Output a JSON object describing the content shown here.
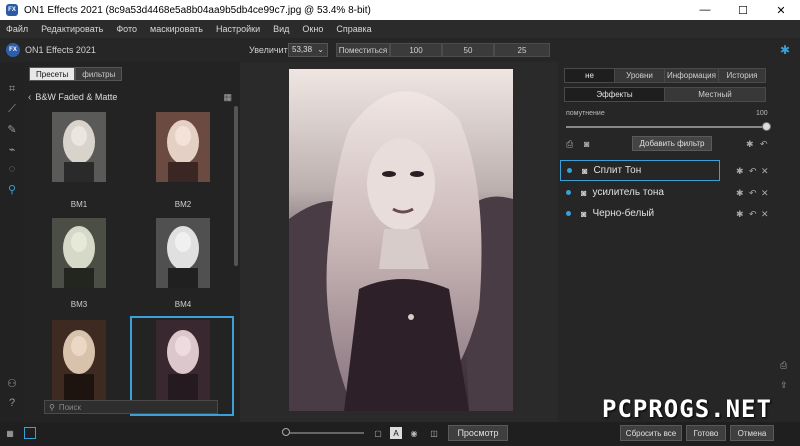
{
  "window": {
    "title": "ON1 Effects 2021 (8c9a53d4468e5a8b04aa9b5db4ce99c7.jpg @ 53.4% 8-bit)",
    "minimize": "—",
    "maximize": "☐",
    "close": "✕"
  },
  "menu": [
    "Файл",
    "Редактировать",
    "Фото",
    "маскировать",
    "Настройки",
    "Вид",
    "Окно",
    "Справка"
  ],
  "toolbar": {
    "logo_text": "FX",
    "product": "ON1 Effects 2021",
    "zoom_label": "Увеличить",
    "zoom_value": "53,38",
    "zoom_dropdown": "⌄",
    "fit_label": "Поместиться",
    "zoom_presets": [
      "100",
      "50",
      "25"
    ]
  },
  "browser": {
    "tabs": [
      {
        "label": "Пресеты",
        "active": true
      },
      {
        "label": "фильтры",
        "active": false
      }
    ],
    "category": "B&W Faded & Matte",
    "presets": [
      {
        "label": "BM1"
      },
      {
        "label": "BM2"
      },
      {
        "label": "BM3"
      },
      {
        "label": "BM4"
      },
      {
        "label": ""
      },
      {
        "label": ""
      }
    ],
    "selected_index": 5,
    "search_placeholder": "Поиск"
  },
  "right_panel": {
    "top_tabs": [
      {
        "label": "не",
        "active": true
      },
      {
        "label": "Уровни",
        "active": false
      },
      {
        "label": "Информация",
        "active": false
      },
      {
        "label": "История",
        "active": false
      }
    ],
    "mode_tabs": [
      {
        "label": "Эффекты",
        "active": true
      },
      {
        "label": "Местный",
        "active": false
      }
    ],
    "opacity_label": "помутнение",
    "opacity_value": "100",
    "add_filter_label": "Добавить фильтр",
    "filters": [
      {
        "name": "Сплит Тон",
        "selected": true
      },
      {
        "name": "усилитель тона",
        "selected": false
      },
      {
        "name": "Черно-белый",
        "selected": false
      }
    ]
  },
  "bottom": {
    "preview_label": "Просмотр",
    "reset_label": "Сбросить все",
    "done_label": "Готово",
    "cancel_label": "Отмена"
  },
  "watermark": "PCPROGS.NET",
  "icons": [
    "settings-icon",
    "search-icon",
    "grid-icon",
    "eye-icon",
    "reset-icon",
    "close-icon"
  ]
}
